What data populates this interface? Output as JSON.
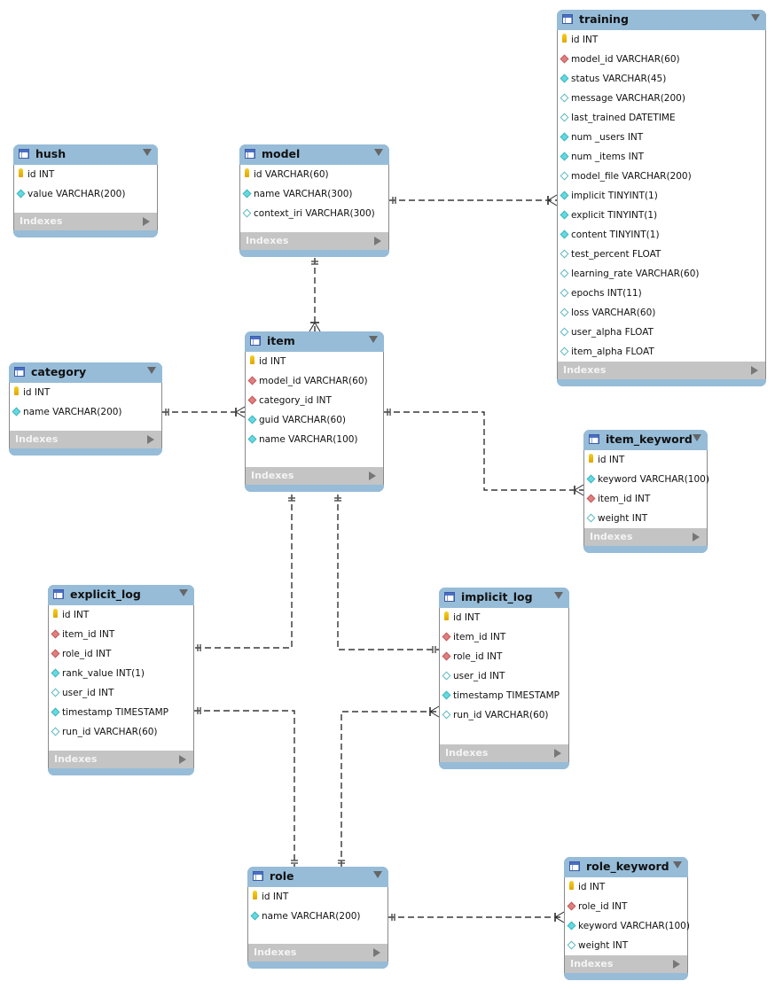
{
  "diagram": {
    "type": "entity-relationship",
    "indexes_label": "Indexes",
    "legend": {
      "pk": "primary-key-icon",
      "fk": "foreign-key-icon",
      "nn": "not-null-column-icon",
      "nl": "nullable-column-icon"
    },
    "colors": {
      "header": "#96bcd8",
      "indexes_bar": "#c4c4c4",
      "pk": "#f0c419",
      "fk": "#e07f7f",
      "not_null": "#66d9e0",
      "nullable": "#ffffff",
      "line": "#000000"
    }
  },
  "tables": {
    "hush": {
      "name": "hush",
      "columns": [
        {
          "label": "id INT",
          "kind": "pk"
        },
        {
          "label": "value VARCHAR(200)",
          "kind": "nn"
        }
      ]
    },
    "model": {
      "name": "model",
      "columns": [
        {
          "label": "id VARCHAR(60)",
          "kind": "pk"
        },
        {
          "label": "name VARCHAR(300)",
          "kind": "nn"
        },
        {
          "label": "context_iri VARCHAR(300)",
          "kind": "nl"
        }
      ]
    },
    "training": {
      "name": "training",
      "columns": [
        {
          "label": "id INT",
          "kind": "pk"
        },
        {
          "label": "model_id VARCHAR(60)",
          "kind": "fk"
        },
        {
          "label": "status VARCHAR(45)",
          "kind": "nn"
        },
        {
          "label": "message VARCHAR(200)",
          "kind": "nl"
        },
        {
          "label": "last_trained DATETIME",
          "kind": "nl"
        },
        {
          "label": "num _users INT",
          "kind": "nn"
        },
        {
          "label": "num _items INT",
          "kind": "nn"
        },
        {
          "label": "model_file VARCHAR(200)",
          "kind": "nl"
        },
        {
          "label": "implicit TINYINT(1)",
          "kind": "nn"
        },
        {
          "label": "explicit TINYINT(1)",
          "kind": "nn"
        },
        {
          "label": "content TINYINT(1)",
          "kind": "nn"
        },
        {
          "label": "test_percent FLOAT",
          "kind": "nl"
        },
        {
          "label": "learning_rate VARCHAR(60)",
          "kind": "nl"
        },
        {
          "label": "epochs INT(11)",
          "kind": "nl"
        },
        {
          "label": "loss VARCHAR(60)",
          "kind": "nl"
        },
        {
          "label": "user_alpha FLOAT",
          "kind": "nl"
        },
        {
          "label": "item_alpha FLOAT",
          "kind": "nl"
        }
      ]
    },
    "category": {
      "name": "category",
      "columns": [
        {
          "label": "id INT",
          "kind": "pk"
        },
        {
          "label": "name VARCHAR(200)",
          "kind": "nn"
        }
      ]
    },
    "item": {
      "name": "item",
      "columns": [
        {
          "label": "id INT",
          "kind": "pk"
        },
        {
          "label": "model_id VARCHAR(60)",
          "kind": "fk"
        },
        {
          "label": "category_id INT",
          "kind": "fk"
        },
        {
          "label": "guid VARCHAR(60)",
          "kind": "nn"
        },
        {
          "label": "name VARCHAR(100)",
          "kind": "nn"
        }
      ]
    },
    "item_keyword": {
      "name": "item_keyword",
      "columns": [
        {
          "label": "id INT",
          "kind": "pk"
        },
        {
          "label": "keyword VARCHAR(100)",
          "kind": "nn"
        },
        {
          "label": "item_id INT",
          "kind": "fk"
        },
        {
          "label": "weight INT",
          "kind": "nl"
        }
      ]
    },
    "explicit_log": {
      "name": "explicit_log",
      "columns": [
        {
          "label": "id INT",
          "kind": "pk"
        },
        {
          "label": "item_id INT",
          "kind": "fk"
        },
        {
          "label": "role_id INT",
          "kind": "fk"
        },
        {
          "label": "rank_value INT(1)",
          "kind": "nn"
        },
        {
          "label": "user_id INT",
          "kind": "nl"
        },
        {
          "label": "timestamp TIMESTAMP",
          "kind": "nn"
        },
        {
          "label": "run_id VARCHAR(60)",
          "kind": "nl"
        }
      ]
    },
    "implicit_log": {
      "name": "implicit_log",
      "columns": [
        {
          "label": "id INT",
          "kind": "pk"
        },
        {
          "label": "item_id INT",
          "kind": "fk"
        },
        {
          "label": "role_id INT",
          "kind": "fk"
        },
        {
          "label": "user_id INT",
          "kind": "nl"
        },
        {
          "label": "timestamp TIMESTAMP",
          "kind": "nn"
        },
        {
          "label": "run_id VARCHAR(60)",
          "kind": "nl"
        }
      ]
    },
    "role": {
      "name": "role",
      "columns": [
        {
          "label": "id INT",
          "kind": "pk"
        },
        {
          "label": "name VARCHAR(200)",
          "kind": "nn"
        }
      ]
    },
    "role_keyword": {
      "name": "role_keyword",
      "columns": [
        {
          "label": "id INT",
          "kind": "pk"
        },
        {
          "label": "role_id INT",
          "kind": "fk"
        },
        {
          "label": "keyword VARCHAR(100)",
          "kind": "nn"
        },
        {
          "label": "weight INT",
          "kind": "nl"
        }
      ]
    }
  },
  "relationships": [
    {
      "from": "model",
      "to": "training",
      "from_card": "one-and-only-one",
      "to_card": "one-or-many"
    },
    {
      "from": "model",
      "to": "item",
      "from_card": "one-and-only-one",
      "to_card": "one-or-many"
    },
    {
      "from": "category",
      "to": "item",
      "from_card": "one-and-only-one",
      "to_card": "one-or-many"
    },
    {
      "from": "item",
      "to": "item_keyword",
      "from_card": "one-and-only-one",
      "to_card": "one-or-many"
    },
    {
      "from": "item",
      "to": "explicit_log",
      "from_card": "one-and-only-one",
      "to_card": "one-and-only-one"
    },
    {
      "from": "item",
      "to": "implicit_log",
      "from_card": "one-and-only-one",
      "to_card": "one-and-only-one"
    },
    {
      "from": "role",
      "to": "explicit_log",
      "from_card": "one-and-only-one",
      "to_card": "one-and-only-one"
    },
    {
      "from": "role",
      "to": "implicit_log",
      "from_card": "one-and-only-one",
      "to_card": "one-or-many"
    },
    {
      "from": "role",
      "to": "role_keyword",
      "from_card": "one-and-only-one",
      "to_card": "one-or-many"
    }
  ]
}
